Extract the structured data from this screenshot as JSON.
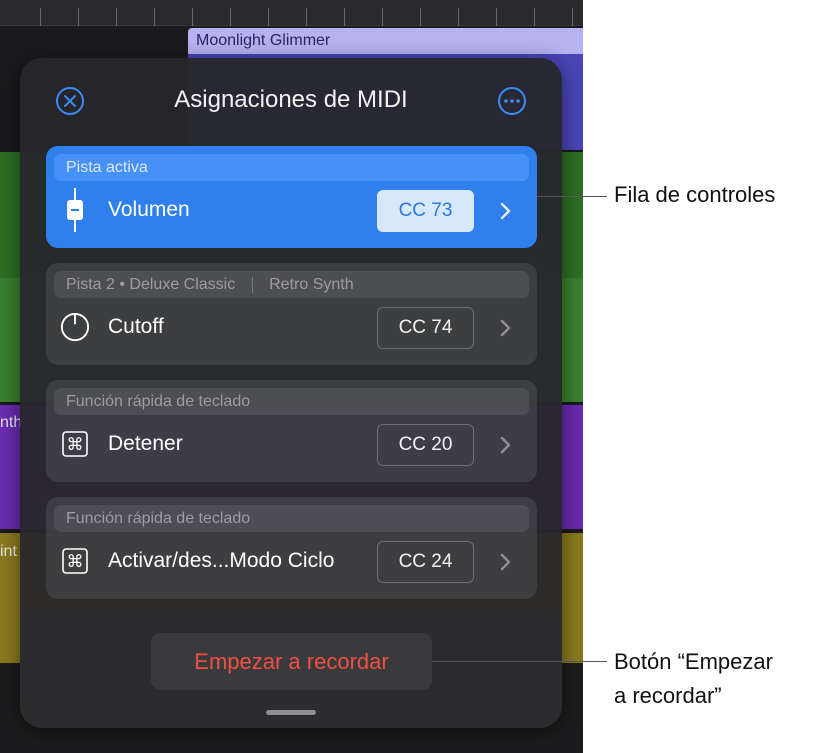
{
  "background": {
    "region_title": "Moonlight Glimmer",
    "track_fragment_1": "nth",
    "track_fragment_2": "int"
  },
  "panel": {
    "title": "Asignaciones de MIDI",
    "close_icon": "close-circle-icon",
    "more_icon": "ellipsis-circle-icon",
    "rows": [
      {
        "header": "Pista activa",
        "icon": "fader-icon",
        "label": "Volumen",
        "cc": "CC 73",
        "active": true
      },
      {
        "header": "Pista 2 • Deluxe Classic",
        "header_extra": "Retro Synth",
        "icon": "knob-icon",
        "label": "Cutoff",
        "cc": "CC 74",
        "active": false
      },
      {
        "header": "Función rápida de teclado",
        "icon": "command-icon",
        "label": "Detener",
        "cc": "CC 20",
        "active": false
      },
      {
        "header": "Función rápida de teclado",
        "icon": "command-icon",
        "label": "Activar/des...Modo Ciclo",
        "cc": "CC 24",
        "active": false
      }
    ],
    "record_button": "Empezar a recordar"
  },
  "callouts": {
    "controls_row": "Fila de controles",
    "record_line1": "Botón “Empezar",
    "record_line2": "a recordar”"
  },
  "colors": {
    "accent": "#2f80ed",
    "record_text": "#ef4f44"
  }
}
